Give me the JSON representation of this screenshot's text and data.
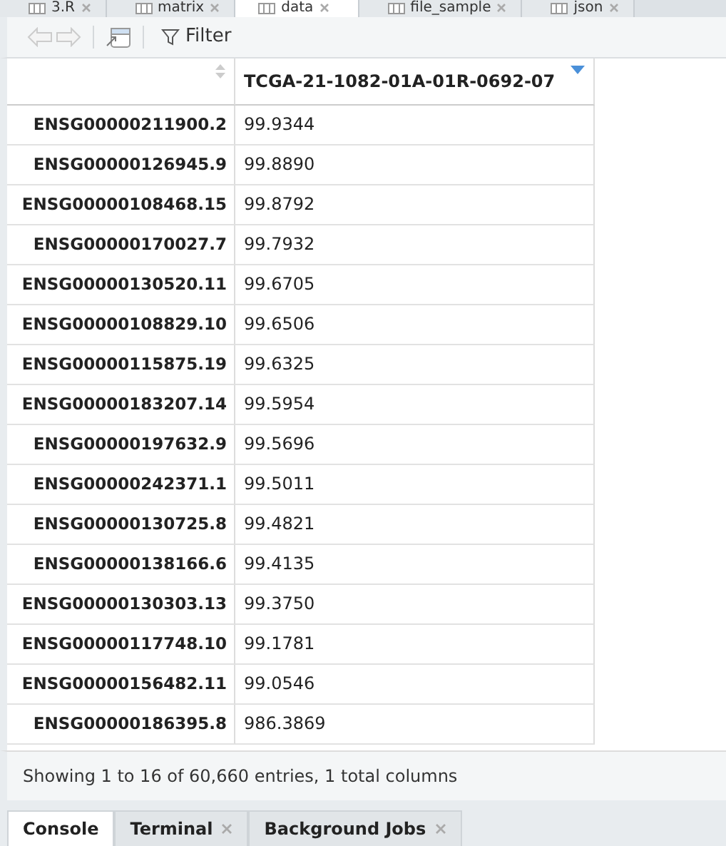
{
  "editor_tabs": [
    {
      "label": "3.R",
      "selected": false,
      "closable": true
    },
    {
      "label": "matrix",
      "selected": false,
      "closable": true
    },
    {
      "label": "data",
      "selected": true,
      "closable": true
    },
    {
      "label": "file_sample",
      "selected": false,
      "closable": true
    },
    {
      "label": "json",
      "selected": false,
      "closable": true
    }
  ],
  "toolbar": {
    "filter_label": "Filter"
  },
  "table": {
    "columns": [
      "",
      "TCGA-21-1082-01A-01R-0692-07"
    ],
    "rows": [
      [
        "ENSG00000211900.2",
        "99.9344"
      ],
      [
        "ENSG00000126945.9",
        "99.8890"
      ],
      [
        "ENSG00000108468.15",
        "99.8792"
      ],
      [
        "ENSG00000170027.7",
        "99.7932"
      ],
      [
        "ENSG00000130520.11",
        "99.6705"
      ],
      [
        "ENSG00000108829.10",
        "99.6506"
      ],
      [
        "ENSG00000115875.19",
        "99.6325"
      ],
      [
        "ENSG00000183207.14",
        "99.5954"
      ],
      [
        "ENSG00000197632.9",
        "99.5696"
      ],
      [
        "ENSG00000242371.1",
        "99.5011"
      ],
      [
        "ENSG00000130725.8",
        "99.4821"
      ],
      [
        "ENSG00000138166.6",
        "99.4135"
      ],
      [
        "ENSG00000130303.13",
        "99.3750"
      ],
      [
        "ENSG00000117748.10",
        "99.1781"
      ],
      [
        "ENSG00000156482.11",
        "99.0546"
      ],
      [
        "ENSG00000186395.8",
        "986.3869"
      ]
    ]
  },
  "status": "Showing 1 to 16 of 60,660 entries, 1 total columns",
  "bottom_tabs": [
    {
      "label": "Console",
      "selected": true,
      "closable": false
    },
    {
      "label": "Terminal",
      "selected": false,
      "closable": true
    },
    {
      "label": "Background Jobs",
      "selected": false,
      "closable": true
    }
  ]
}
